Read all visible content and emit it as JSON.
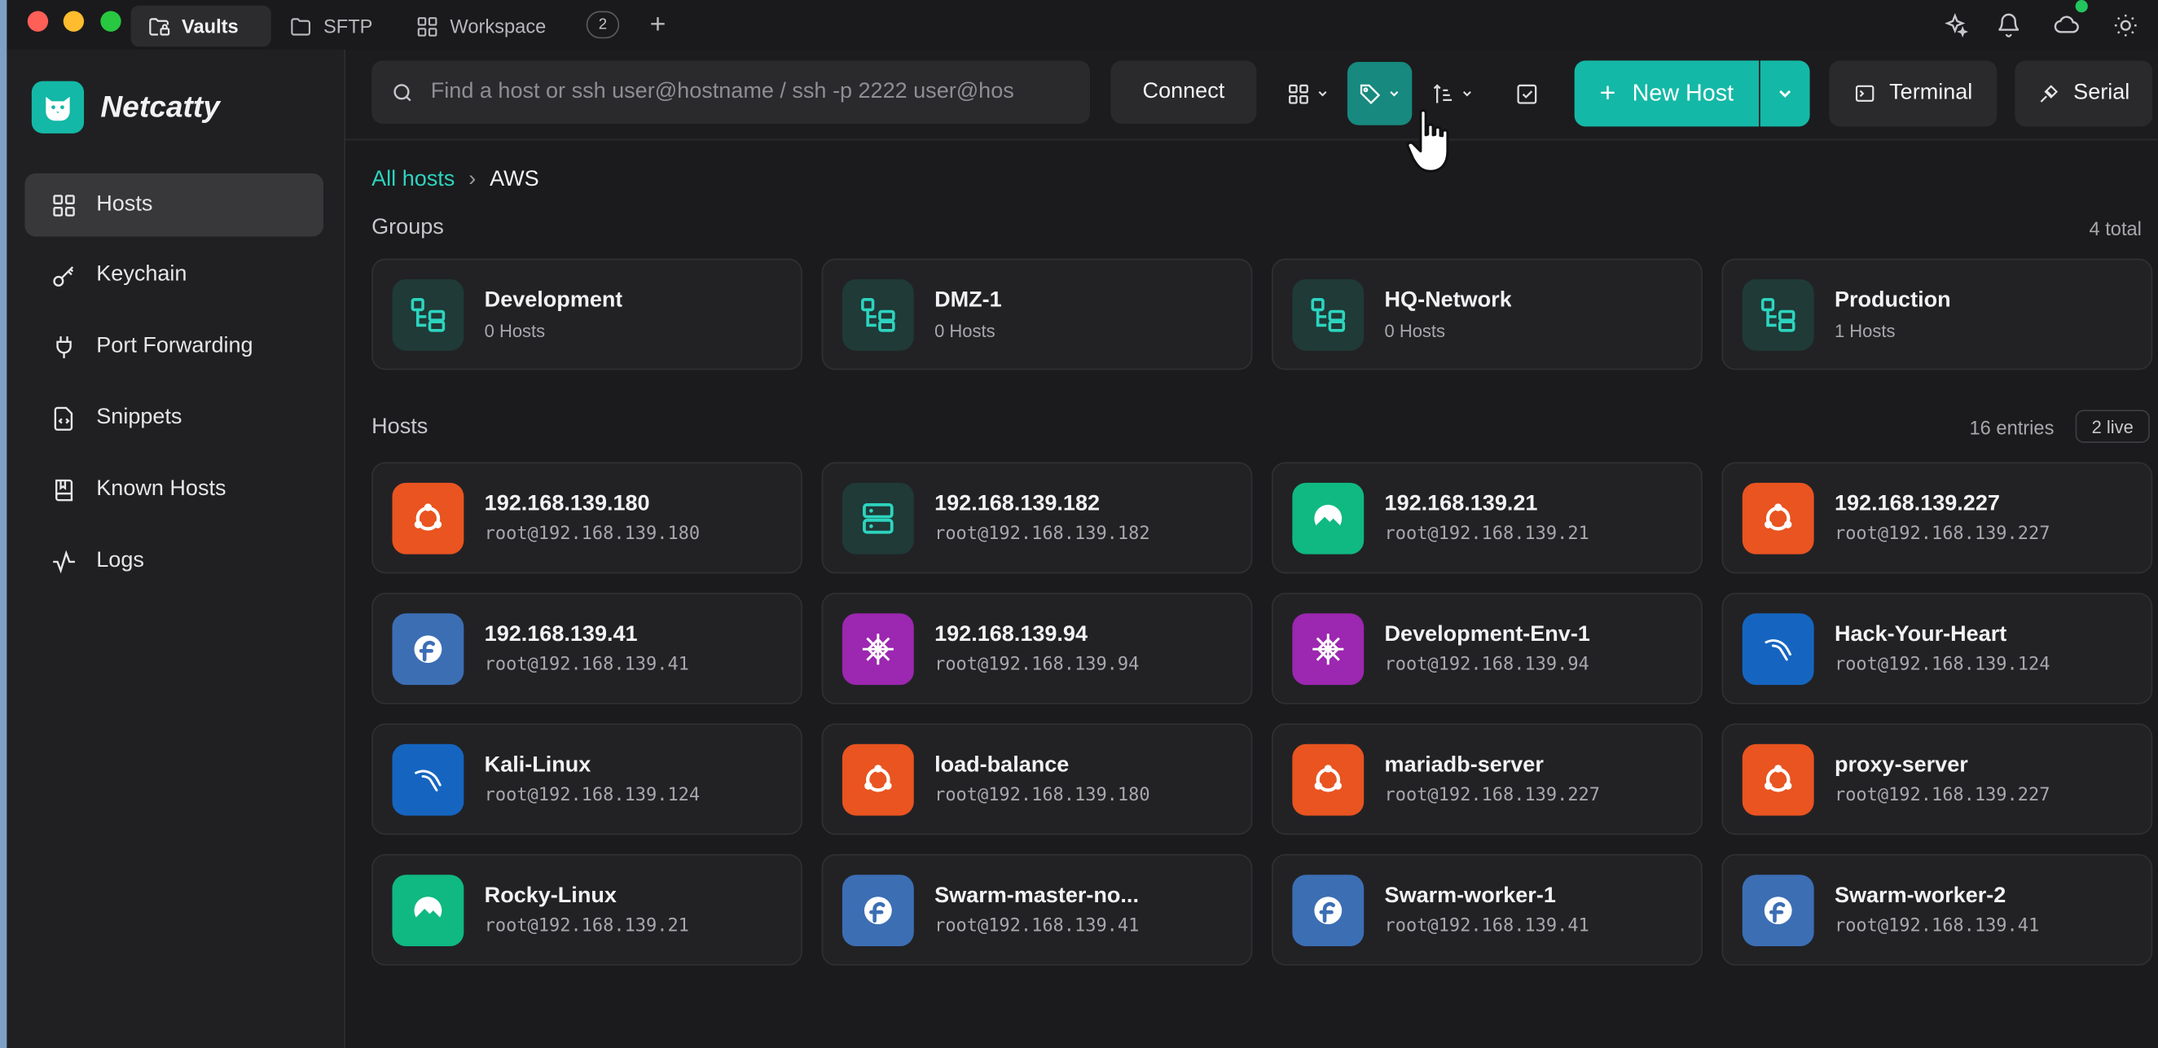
{
  "titlebar": {
    "tabs": [
      {
        "label": "Vaults"
      },
      {
        "label": "SFTP"
      },
      {
        "label": "Workspace"
      }
    ],
    "workspace_count": "2",
    "add_tab": "+"
  },
  "sidebar": {
    "brand": "Netcatty",
    "items": [
      {
        "label": "Hosts",
        "icon": "grid-icon",
        "active": true
      },
      {
        "label": "Keychain",
        "icon": "key-icon"
      },
      {
        "label": "Port Forwarding",
        "icon": "plug-icon"
      },
      {
        "label": "Snippets",
        "icon": "file-code-icon"
      },
      {
        "label": "Known Hosts",
        "icon": "book-icon"
      },
      {
        "label": "Logs",
        "icon": "activity-icon"
      }
    ]
  },
  "toolbar": {
    "search_placeholder": "Find a host or ssh user@hostname / ssh -p 2222 user@hos",
    "connect_label": "Connect",
    "new_host_label": "New Host",
    "terminal_label": "Terminal",
    "serial_label": "Serial"
  },
  "breadcrumb": {
    "root": "All hosts",
    "separator": "›",
    "current": "AWS"
  },
  "groups": {
    "title": "Groups",
    "total": "4 total",
    "items": [
      {
        "name": "Development",
        "count": "0 Hosts"
      },
      {
        "name": "DMZ-1",
        "count": "0 Hosts"
      },
      {
        "name": "HQ-Network",
        "count": "0 Hosts"
      },
      {
        "name": "Production",
        "count": "1 Hosts"
      }
    ]
  },
  "hosts": {
    "title": "Hosts",
    "entries": "16 entries",
    "live": "2 live",
    "items": [
      {
        "name": "192.168.139.180",
        "user": "root@192.168.139.180",
        "os": "ubuntu"
      },
      {
        "name": "192.168.139.182",
        "user": "root@192.168.139.182",
        "os": "server"
      },
      {
        "name": "192.168.139.21",
        "user": "root@192.168.139.21",
        "os": "rocky"
      },
      {
        "name": "192.168.139.227",
        "user": "root@192.168.139.227",
        "os": "ubuntu"
      },
      {
        "name": "192.168.139.41",
        "user": "root@192.168.139.41",
        "os": "fedora"
      },
      {
        "name": "192.168.139.94",
        "user": "root@192.168.139.94",
        "os": "centos"
      },
      {
        "name": "Development-Env-1",
        "user": "root@192.168.139.94",
        "os": "centos"
      },
      {
        "name": "Hack-Your-Heart",
        "user": "root@192.168.139.124",
        "os": "kali"
      },
      {
        "name": "Kali-Linux",
        "user": "root@192.168.139.124",
        "os": "kali"
      },
      {
        "name": "load-balance",
        "user": "root@192.168.139.180",
        "os": "ubuntu"
      },
      {
        "name": "mariadb-server",
        "user": "root@192.168.139.227",
        "os": "ubuntu"
      },
      {
        "name": "proxy-server",
        "user": "root@192.168.139.227",
        "os": "ubuntu"
      },
      {
        "name": "Rocky-Linux",
        "user": "root@192.168.139.21",
        "os": "rocky"
      },
      {
        "name": "Swarm-master-no...",
        "user": "root@192.168.139.41",
        "os": "fedora"
      },
      {
        "name": "Swarm-worker-1",
        "user": "root@192.168.139.41",
        "os": "fedora"
      },
      {
        "name": "Swarm-worker-2",
        "user": "root@192.168.139.41",
        "os": "fedora"
      }
    ]
  },
  "colors": {
    "accent": "#14b8a6",
    "ubuntu": "#e95420",
    "server": "#1f3a37",
    "rocky": "#10b981",
    "fedora": "#3c6eb4",
    "centos": "#9c27b0",
    "kali": "#1565c0"
  }
}
